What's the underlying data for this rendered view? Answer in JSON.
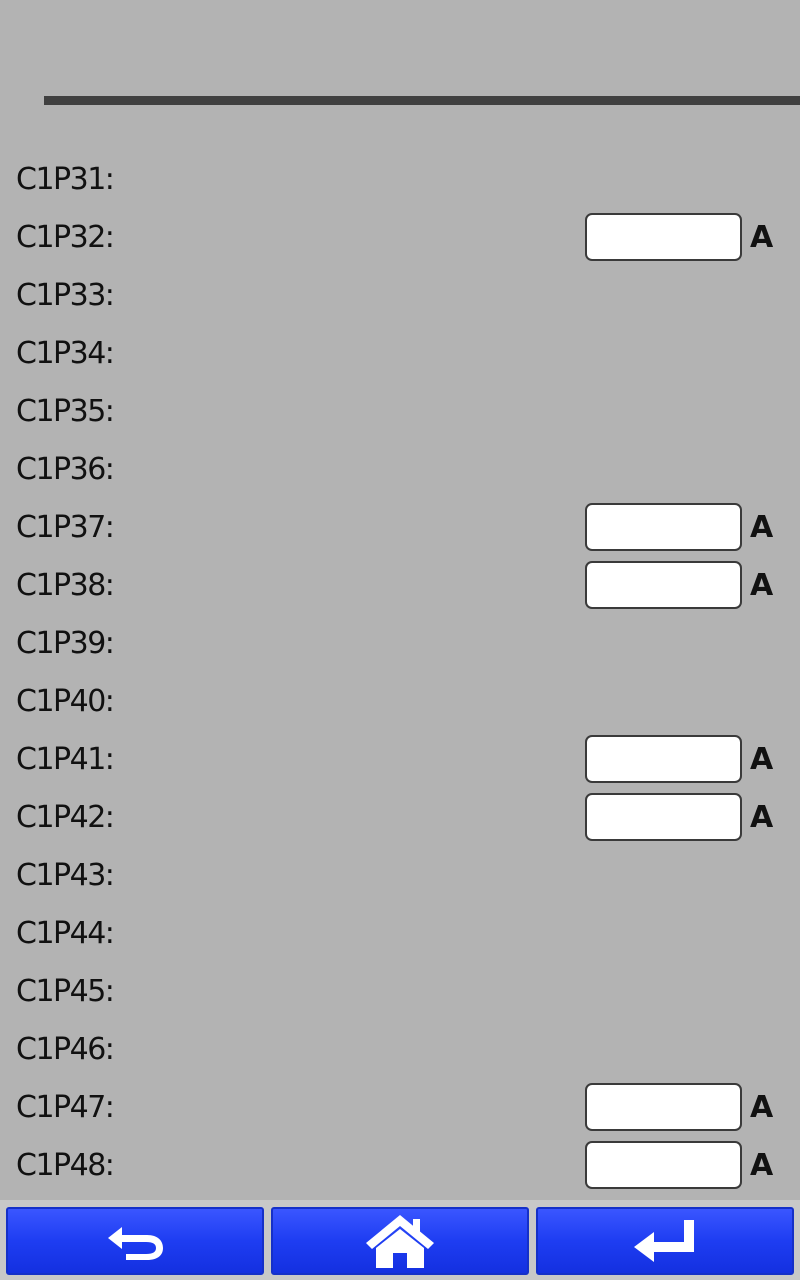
{
  "rows": [
    {
      "label": "C1P31:",
      "has_input": false
    },
    {
      "label": "C1P32:",
      "has_input": true,
      "value": "",
      "unit": "A"
    },
    {
      "label": "C1P33:",
      "has_input": false
    },
    {
      "label": "C1P34:",
      "has_input": false
    },
    {
      "label": "C1P35:",
      "has_input": false
    },
    {
      "label": "C1P36:",
      "has_input": false
    },
    {
      "label": "C1P37:",
      "has_input": true,
      "value": "",
      "unit": "A"
    },
    {
      "label": "C1P38:",
      "has_input": true,
      "value": "",
      "unit": "A"
    },
    {
      "label": "C1P39:",
      "has_input": false
    },
    {
      "label": "C1P40:",
      "has_input": false
    },
    {
      "label": "C1P41:",
      "has_input": true,
      "value": "",
      "unit": "A"
    },
    {
      "label": "C1P42:",
      "has_input": true,
      "value": "",
      "unit": "A"
    },
    {
      "label": "C1P43:",
      "has_input": false
    },
    {
      "label": "C1P44:",
      "has_input": false
    },
    {
      "label": "C1P45:",
      "has_input": false
    },
    {
      "label": "C1P46:",
      "has_input": false
    },
    {
      "label": "C1P47:",
      "has_input": true,
      "value": "",
      "unit": "A"
    },
    {
      "label": "C1P48:",
      "has_input": true,
      "value": "",
      "unit": "A"
    }
  ],
  "nav": {
    "back_icon": "back-arrow-icon",
    "home_icon": "home-icon",
    "enter_icon": "enter-return-icon"
  },
  "colors": {
    "background": "#b3b3b3",
    "header_bar": "#404040",
    "button_blue": "#1e3df2"
  }
}
